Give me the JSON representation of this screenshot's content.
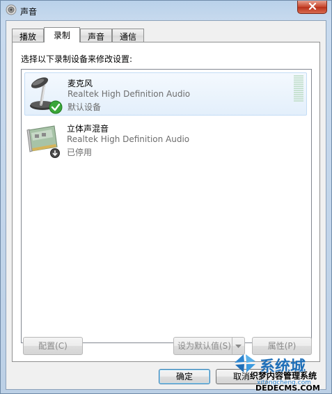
{
  "window": {
    "title": "声音"
  },
  "tabs": [
    {
      "label": "播放",
      "active": false
    },
    {
      "label": "录制",
      "active": true
    },
    {
      "label": "声音",
      "active": false
    },
    {
      "label": "通信",
      "active": false
    }
  ],
  "panel": {
    "instruction": "选择以下录制设备来修改设置:"
  },
  "devices": [
    {
      "name": "麦克风",
      "description": "Realtek High Definition Audio",
      "status": "默认设备",
      "icon": "microphone-icon",
      "badge": "default-check-icon",
      "selected": true,
      "level": 0
    },
    {
      "name": "立体声混音",
      "description": "Realtek High Definition Audio",
      "status": "已停用",
      "icon": "sound-card-icon",
      "badge": "disabled-arrow-icon",
      "selected": false
    }
  ],
  "buttons": {
    "configure": "配置(C)",
    "set_default": "设为默认值(S)",
    "properties": "属性(P)",
    "ok": "确定",
    "cancel": "取消"
  },
  "watermark": {
    "brand": "系统城",
    "site_cn": "织梦内容管理系统",
    "url": "xitongcheng.com",
    "url2": "DEDECMS.COM"
  },
  "colors": {
    "title_bar": "#b9d1ea",
    "selection": "#e3effb",
    "check_green": "#3aa63a",
    "watermark_blue": "#1f6fb8"
  }
}
